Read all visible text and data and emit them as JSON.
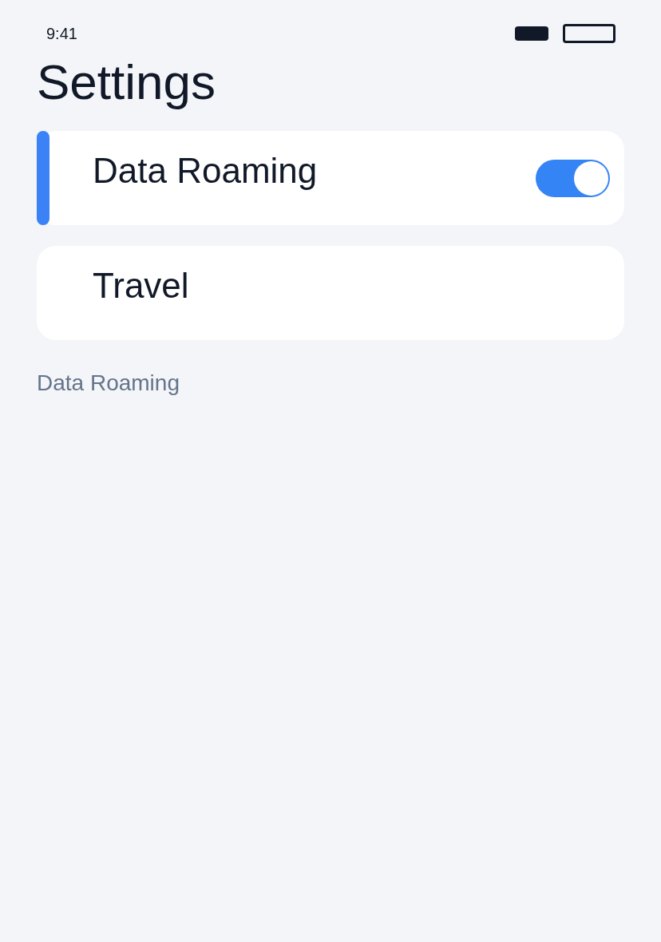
{
  "status_bar": {
    "time": "9:41"
  },
  "title": "Settings",
  "items": [
    {
      "label": "Data Roaming",
      "kind": "toggle",
      "selected": true,
      "on": true
    },
    {
      "label": "Travel",
      "kind": "link",
      "selected": false
    }
  ],
  "footer": "Data Roaming"
}
